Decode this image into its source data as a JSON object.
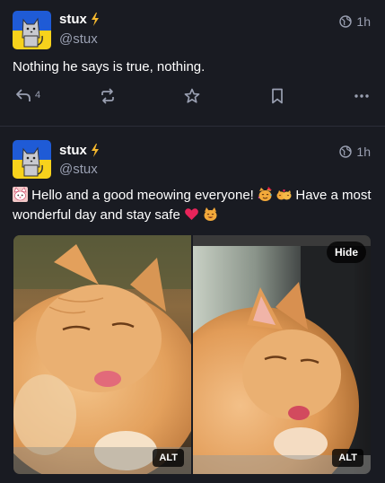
{
  "colors": {
    "background": "#191b22",
    "text_secondary": "#9aa0b2",
    "avatar_blue": "#1f5bd6",
    "avatar_yellow": "#f7d21c",
    "heart": "#e8245a"
  },
  "posts": [
    {
      "display_name": "stux",
      "bot_icon": "lightning-bolt-icon",
      "handle": "@stux",
      "visibility_icon": "globe-icon",
      "time": "1h",
      "content": "Nothing he says is true, nothing.",
      "actions": {
        "reply_count": "4",
        "reply_icon": "reply-icon",
        "boost_icon": "boost-icon",
        "favourite_icon": "star-icon",
        "bookmark_icon": "bookmark-icon",
        "more_icon": "more-icon"
      }
    },
    {
      "display_name": "stux",
      "bot_icon": "lightning-bolt-icon",
      "handle": "@stux",
      "visibility_icon": "globe-icon",
      "time": "1h",
      "content_part1": "Hello and a good meowing everyone!",
      "content_part2": "Have a most wonderful day and stay safe",
      "emoji": [
        "cat-face-emoji",
        "party-cat-emoji",
        "cat-hug-emoji",
        "heart-emoji",
        "smiling-cat-emoji"
      ],
      "media": {
        "hide_label": "Hide",
        "alt_label_1": "ALT",
        "alt_label_2": "ALT"
      }
    }
  ]
}
